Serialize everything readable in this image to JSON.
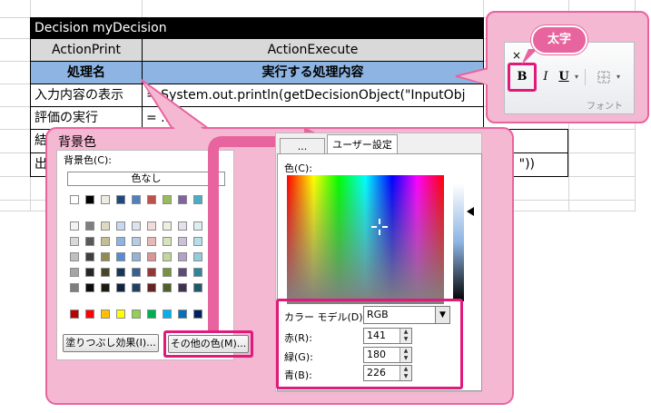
{
  "sheet": {
    "title": "Decision myDecision",
    "col_headers": [
      "ActionPrint",
      "ActionExecute"
    ],
    "bold_headers": [
      "処理名",
      "実行する処理内容"
    ],
    "rows": [
      {
        "name": "入力内容の表示",
        "content": "= System.out.println(getDecisionObject(\"InputObj"
      },
      {
        "name": "評価の実行",
        "content": "= ..."
      },
      {
        "name": "結",
        "content": ""
      },
      {
        "name": "出",
        "content": "\"))"
      }
    ]
  },
  "callout": {
    "title": "背景色"
  },
  "palette": {
    "label": "背景色(C):",
    "no_fill": "色なし",
    "fill_effects_button": "塗りつぶし効果(I)...",
    "more_colors_button": "その他の色(M)..."
  },
  "dialog": {
    "tab_standard": "...",
    "tab_custom": "ユーザー設定",
    "color_label": "色(C):",
    "model_label": "カラー モデル(D):",
    "model_value": "RGB",
    "red_label": "赤(R):",
    "red_value": "141",
    "green_label": "緑(G):",
    "green_value": "180",
    "blue_label": "青(B):",
    "blue_value": "226"
  },
  "ribbon": {
    "bold_label": "B",
    "italic_label": "I",
    "underline_label": "U",
    "group_label": "フォント",
    "tooltip": "太字",
    "close_glyph": "×"
  },
  "colors": {
    "accent_pink": "#e0197a",
    "callout_bg": "#f5b8d2",
    "header_blue": "#8db4e2"
  }
}
